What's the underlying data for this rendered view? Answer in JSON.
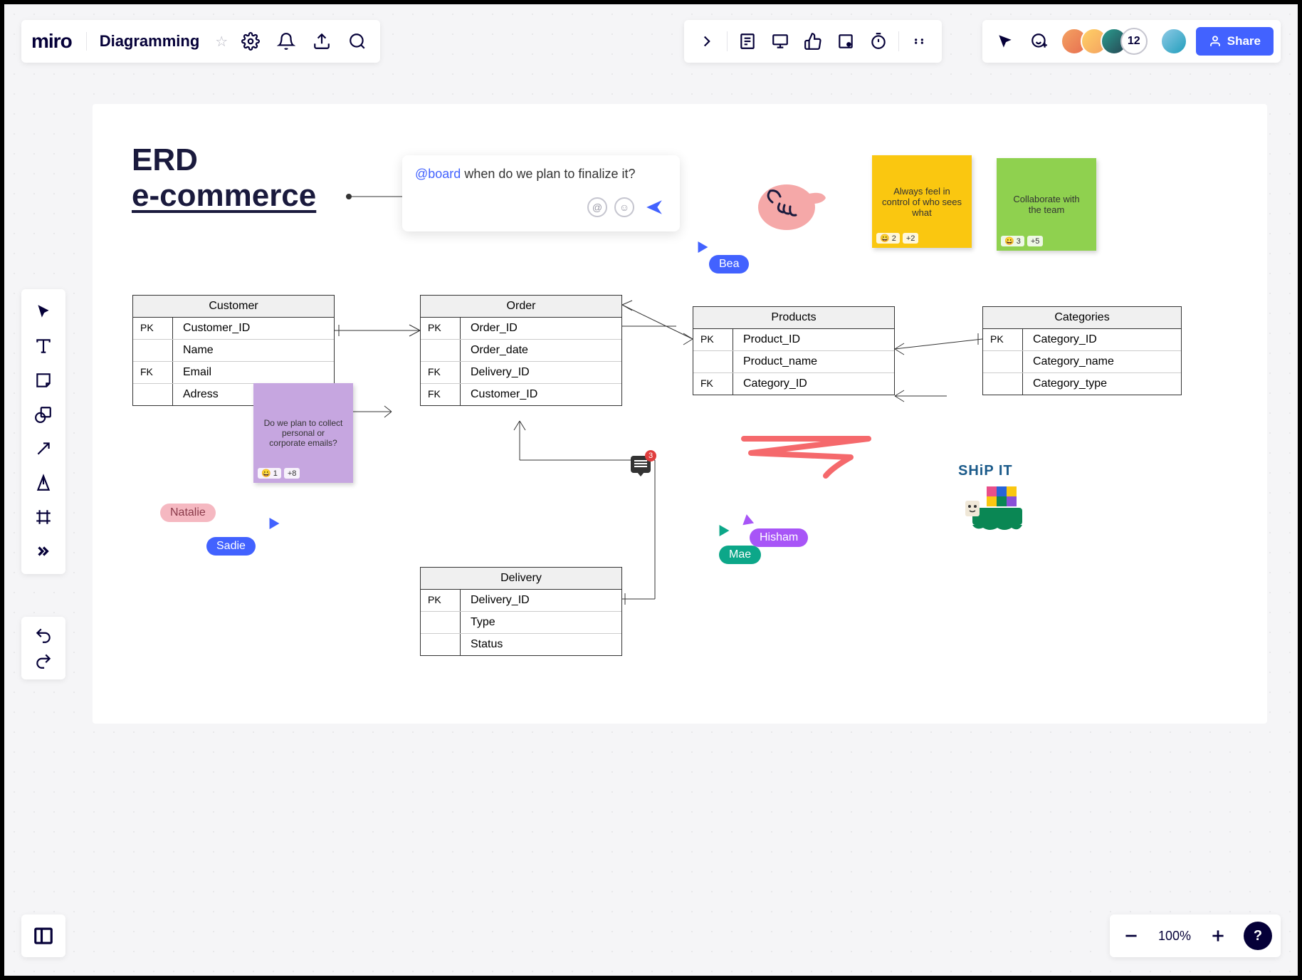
{
  "app": {
    "logo": "miro",
    "board_name": "Diagramming"
  },
  "collab": {
    "extra_count": "12",
    "share_label": "Share"
  },
  "zoom": {
    "level": "100%"
  },
  "help": "?",
  "title": {
    "line1": "ERD",
    "line2": "e-commerce"
  },
  "comment": {
    "mention": "@board",
    "text": " when do we plan to finalize it?"
  },
  "entities": {
    "customer": {
      "name": "Customer",
      "rows": [
        {
          "key": "PK",
          "field": "Customer_ID"
        },
        {
          "key": "",
          "field": "Name"
        },
        {
          "key": "FK",
          "field": "Email"
        },
        {
          "key": "",
          "field": "Adress"
        }
      ]
    },
    "order": {
      "name": "Order",
      "rows": [
        {
          "key": "PK",
          "field": "Order_ID"
        },
        {
          "key": "",
          "field": "Order_date"
        },
        {
          "key": "FK",
          "field": "Delivery_ID"
        },
        {
          "key": "FK",
          "field": "Customer_ID"
        }
      ]
    },
    "products": {
      "name": "Products",
      "rows": [
        {
          "key": "PK",
          "field": "Product_ID"
        },
        {
          "key": "",
          "field": "Product_name"
        },
        {
          "key": "FK",
          "field": "Category_ID"
        }
      ]
    },
    "categories": {
      "name": "Categories",
      "rows": [
        {
          "key": "PK",
          "field": "Category_ID"
        },
        {
          "key": "",
          "field": "Category_name"
        },
        {
          "key": "",
          "field": "Category_type"
        }
      ]
    },
    "delivery": {
      "name": "Delivery",
      "rows": [
        {
          "key": "PK",
          "field": "Delivery_ID"
        },
        {
          "key": "",
          "field": "Type"
        },
        {
          "key": "",
          "field": "Status"
        }
      ]
    }
  },
  "stickies": {
    "yellow": {
      "text": "Always feel in control of who sees what",
      "reaction": "😀 2",
      "add": "+2"
    },
    "green": {
      "text": "Collaborate with the team",
      "reaction": "😀 3",
      "add": "+5"
    },
    "purple": {
      "text": "Do we plan to collect personal or corporate emails?",
      "reaction": "😀 1",
      "add": "+8"
    }
  },
  "users": {
    "bea": "Bea",
    "natalie": "Natalie",
    "sadie": "Sadie",
    "mae": "Mae",
    "hisham": "Hisham"
  },
  "chat": {
    "count": "3"
  },
  "shipit": {
    "text": "SHiP IT"
  }
}
